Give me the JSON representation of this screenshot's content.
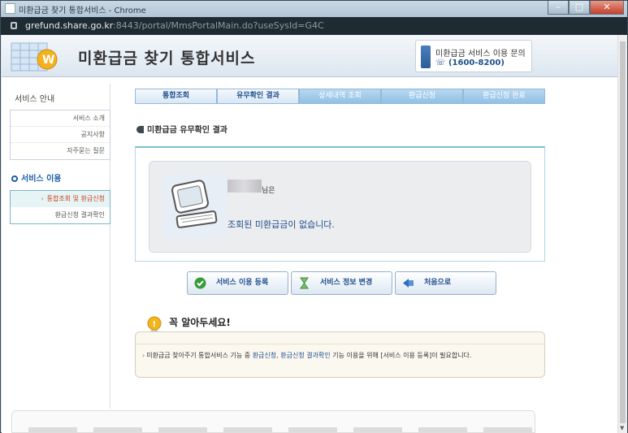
{
  "window": {
    "title": "미환급금 찾기 통합서비스 - Chrome",
    "controls": {
      "minimize": "–",
      "maximize": "□",
      "close": "✕"
    }
  },
  "address": {
    "host": "grefund.share.go.kr",
    "path": ":8443/portal/MmsPortalMain.do?useSysId=G4C"
  },
  "header": {
    "title": "미환급금 찾기 통합서비스",
    "contact_label": "미환급금 서비스 이용 문의",
    "contact_number": "☏ (1600-8200)"
  },
  "sidebar": {
    "heading": "서비스 안내",
    "info_items": [
      "서비스 소개",
      "공지사항",
      "자주묻는 질문"
    ],
    "active_heading": "서비스 이용",
    "use_items": [
      {
        "label": "통합조회 및 환급신청",
        "selected": true
      },
      {
        "label": "환급신청 결과확인",
        "selected": false
      }
    ]
  },
  "steps": [
    "통합조회",
    "유무확인 결과",
    "상세내역 조회",
    "환급신청",
    "환급신청 완료"
  ],
  "section_title": "미환급금 유무확인 결과",
  "result": {
    "name_suffix": "님은",
    "message": "조회된 미환급금이 없습니다."
  },
  "buttons": {
    "register": "서비스 이용 등록",
    "change": "서비스 정보 변경",
    "home": "처음으로"
  },
  "notice": {
    "title": "꼭 알아두세요!",
    "text_prefix": "미환급금 찾아주기 통합서비스 기능 중 ",
    "link1": "환급신청",
    "separator": ", ",
    "link2": "환급신청 결과확인",
    "text_suffix": " 기능 이용을 위해 [서비스 이용 등록]이 필요합니다."
  }
}
